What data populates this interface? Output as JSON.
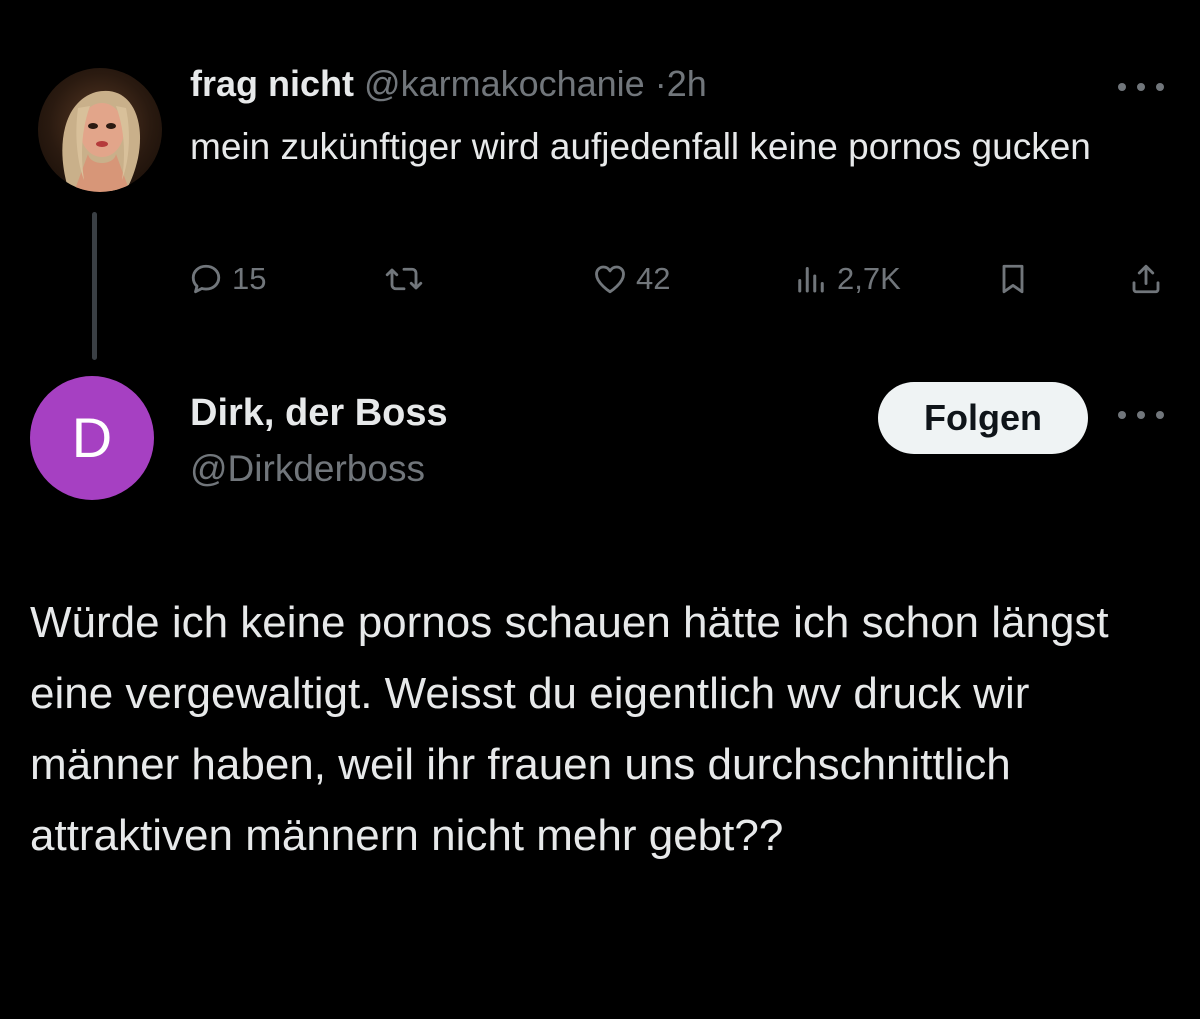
{
  "tweet1": {
    "display_name": "frag nicht",
    "handle": "@karmakochanie",
    "separator": "·",
    "time": "2h",
    "text": "mein zukünftiger wird aufjedenfall keine pornos gucken",
    "actions": {
      "replies": "15",
      "reposts": "",
      "likes": "42",
      "views": "2,7K"
    },
    "icons": {
      "reply": "reply-icon",
      "repost": "repost-icon",
      "like": "heart-icon",
      "views": "views-icon",
      "bookmark": "bookmark-icon",
      "share": "share-icon",
      "more": "more-icon"
    }
  },
  "tweet2": {
    "avatar_letter": "D",
    "display_name": "Dirk, der Boss",
    "handle": "@Dirkderboss",
    "follow_label": "Folgen",
    "text": "Würde ich keine pornos schauen hätte ich schon längst eine vergewaltigt. Weisst du eigentlich wv druck wir männer haben, weil ihr frauen uns durchschnittlich attraktiven männern nicht mehr gebt??"
  },
  "colors": {
    "background": "#000000",
    "text_primary": "#e7e9ea",
    "text_secondary": "#71767b",
    "avatar_purple": "#a640c2",
    "follow_button_bg": "#eff3f4",
    "thread_line": "#3a3f44"
  }
}
